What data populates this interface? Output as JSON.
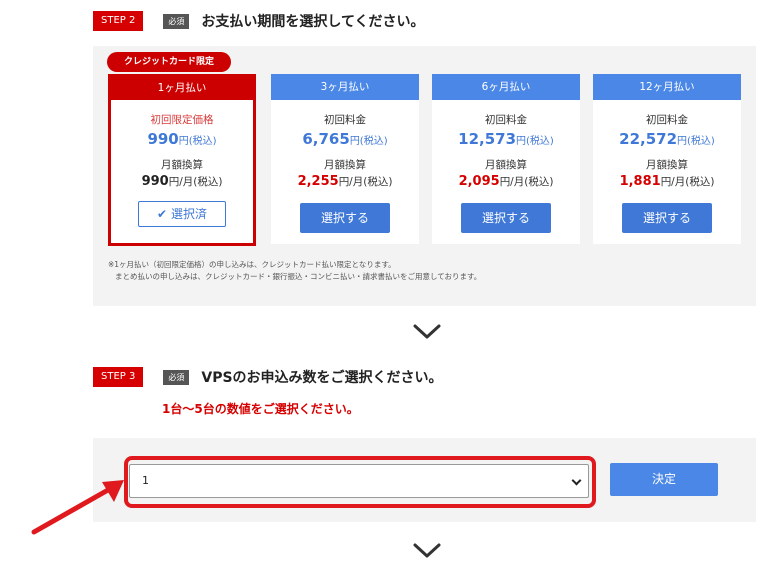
{
  "step2": {
    "badge": "STEP 2",
    "required": "必須",
    "title": "お支払い期間を選択してください。",
    "cc_tag": "クレジットカード限定",
    "plans": [
      {
        "period": "1ヶ月払い",
        "price_label": "初回限定価格",
        "price": "990",
        "price_unit": "円(税込)",
        "monthly_label": "月額換算",
        "monthly": "990",
        "monthly_unit": "円/月(税込)",
        "button": "選択済",
        "selected": true
      },
      {
        "period": "3ヶ月払い",
        "price_label": "初回料金",
        "price": "6,765",
        "price_unit": "円(税込)",
        "monthly_label": "月額換算",
        "monthly": "2,255",
        "monthly_unit": "円/月(税込)",
        "button": "選択する",
        "selected": false
      },
      {
        "period": "6ヶ月払い",
        "price_label": "初回料金",
        "price": "12,573",
        "price_unit": "円(税込)",
        "monthly_label": "月額換算",
        "monthly": "2,095",
        "monthly_unit": "円/月(税込)",
        "button": "選択する",
        "selected": false
      },
      {
        "period": "12ヶ月払い",
        "price_label": "初回料金",
        "price": "22,572",
        "price_unit": "円(税込)",
        "monthly_label": "月額換算",
        "monthly": "1,881",
        "monthly_unit": "円/月(税込)",
        "button": "選択する",
        "selected": false
      }
    ],
    "note_line1": "※1ヶ月払い（初回限定価格）の申し込みは、クレジットカード払い限定となります。",
    "note_line2": "まとめ払いの申し込みは、クレジットカード・銀行振込・コンビニ払い・請求書払いをご用意しております。"
  },
  "step3": {
    "badge": "STEP 3",
    "required": "必須",
    "title": "VPSのお申込み数をご選択ください。",
    "subtitle": "1台～5台の数値をご選択ください。",
    "select_value": "1",
    "decide_button": "決定"
  },
  "colors": {
    "brand_red": "#cc0000",
    "accent_blue": "#4a87e6",
    "highlight_red": "#e0191e"
  },
  "icons": [
    "check-icon",
    "chevron-down-icon",
    "arrow-pointer-icon"
  ]
}
